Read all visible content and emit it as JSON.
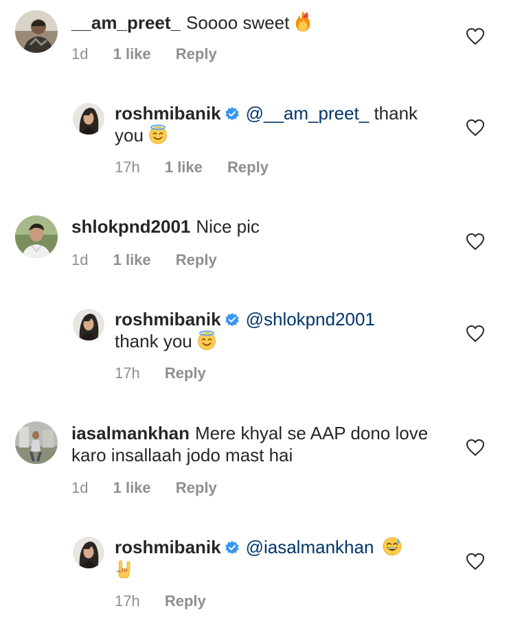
{
  "comments": [
    {
      "username": "__am_preet_",
      "text": "Soooo sweet",
      "emoji": "fire-emoji",
      "time": "1d",
      "likes": "1 like",
      "reply_label": "Reply"
    },
    {
      "username": "roshmibanik",
      "mention": "@__am_preet_",
      "text": "thank you",
      "emoji": "halo-smile-emoji",
      "time": "17h",
      "likes": "1 like",
      "reply_label": "Reply"
    },
    {
      "username": "shlokpnd2001",
      "text": "Nice pic",
      "time": "1d",
      "likes": "1 like",
      "reply_label": "Reply"
    },
    {
      "username": "roshmibanik",
      "mention": "@shlokpnd2001",
      "text": "thank you",
      "emoji": "halo-smile-emoji",
      "time": "17h",
      "reply_label": "Reply"
    },
    {
      "username": "iasalmankhan",
      "text": "Mere khyal se AAP dono love karo insallaah jodo mast hai",
      "time": "1d",
      "likes": "1 like",
      "reply_label": "Reply"
    },
    {
      "username": "roshmibanik",
      "mention": "@iasalmankhan",
      "emoji": "sweat-smile-emoji",
      "emoji2": "rock-hand-emoji",
      "time": "17h",
      "reply_label": "Reply"
    }
  ],
  "colors": {
    "text": "#262626",
    "meta": "#8e8e8e",
    "mention": "#003569",
    "verified": "#3897f0"
  }
}
